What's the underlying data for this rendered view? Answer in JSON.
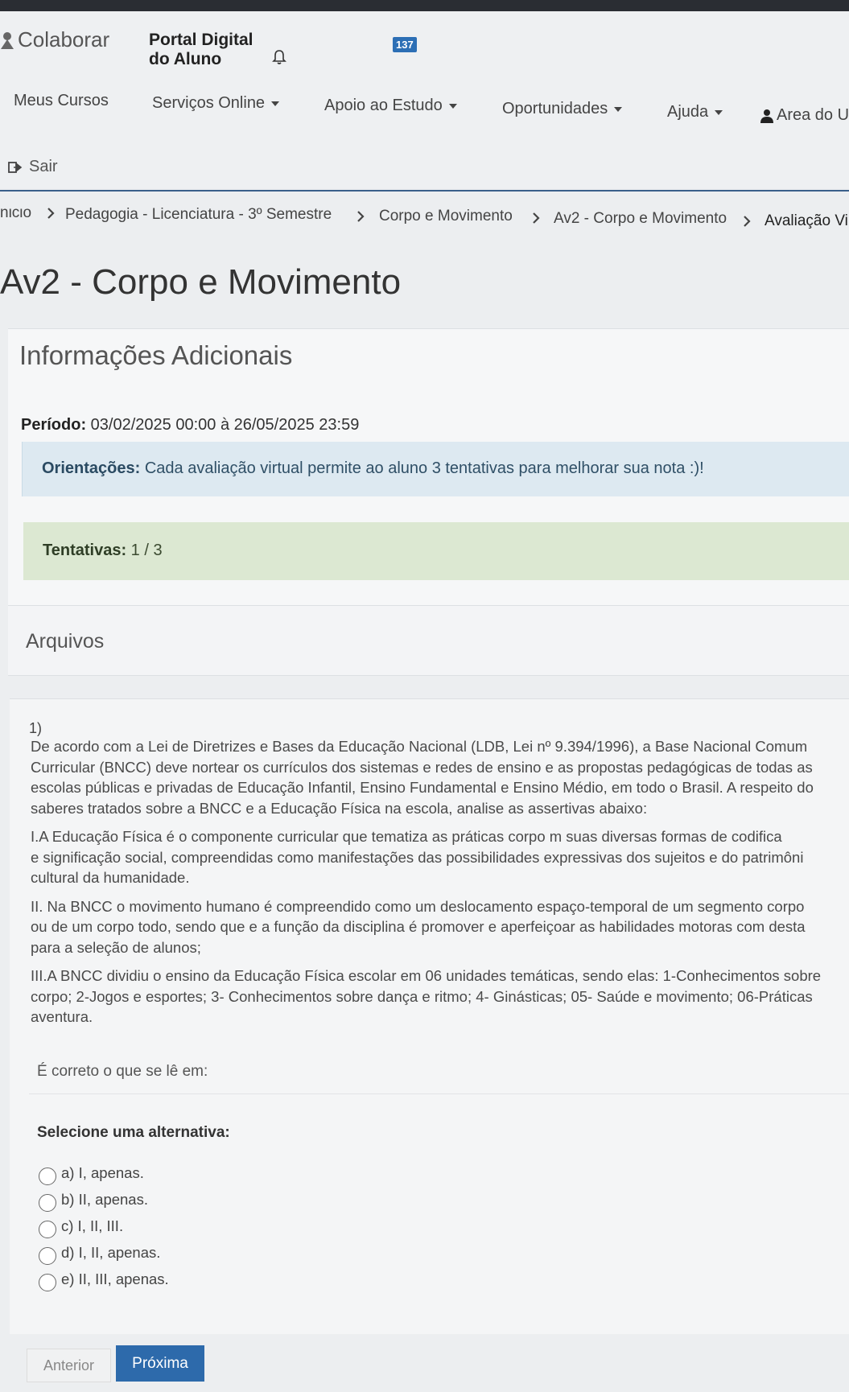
{
  "header": {
    "brand": "Colaborar",
    "portal_line1": "Portal Digital",
    "portal_line2": "do Aluno",
    "notification_count": "137",
    "sair_label": "Sair"
  },
  "nav": {
    "items": [
      {
        "label": "Meus Cursos"
      },
      {
        "label": "Serviços Online"
      },
      {
        "label": "Apoio ao Estudo"
      },
      {
        "label": "Oportunidades"
      },
      {
        "label": "Ajuda"
      },
      {
        "label": "Area do U"
      }
    ]
  },
  "breadcrumb": [
    "nicio",
    "Pedagogia - Licenciatura - 3º Semestre",
    "Corpo e Movimento",
    "Av2 - Corpo e Movimento",
    "Avaliação Vi"
  ],
  "page_title": "Av2 - Corpo e Movimento",
  "info": {
    "title": "Informações Adicionais",
    "periodo_label": "Período:",
    "periodo_value": " 03/02/2025 00:00 à 26/05/2025 23:59",
    "orient_label": "Orientações:",
    "orient_value": " Cada avaliação virtual permite ao aluno 3 tentativas para melhorar sua nota :)!",
    "tentativas_label": "Tentativas:",
    "tentativas_value": " 1 / 3",
    "arquivos_title": "Arquivos"
  },
  "question": {
    "number": "1)",
    "paragraphs": [
      [
        "De acordo com a Lei de Diretrizes e Bases da Educação Nacional (LDB, Lei nº 9.394/1996), a Base Nacional Comum",
        "Curricular (BNCC) deve nortear os currículos dos sistemas e redes de ensino e as propostas pedagógicas de todas as",
        "escolas públicas e privadas de Educação Infantil, Ensino Fundamental e Ensino Médio, em todo o Brasil. A respeito do",
        "saberes tratados sobre a BNCC e a Educação Física na escola, analise as assertivas abaixo:"
      ],
      [
        "I.A Educação Física é o componente curricular que tematiza as práticas corpo       m suas diversas formas de codifica",
        "e significação social, compreendidas como manifestações das possibilidades expressivas dos sujeitos e do patrimôni",
        "cultural da humanidade."
      ],
      [
        "II. Na BNCC o movimento humano é compreendido como um deslocamento espaço-temporal de um segmento corpo",
        "ou de um corpo todo, sendo que e a função da disciplina é promover e aperfeiçoar as habilidades motoras com desta",
        "para a seleção de alunos;"
      ],
      [
        "III.A BNCC dividiu o ensino da Educação Física escolar em 06 unidades temáticas, sendo elas: 1-Conhecimentos sobre",
        "corpo; 2-Jogos e esportes; 3- Conhecimentos sobre dança e ritmo; 4- Ginásticas; 05- Saúde e movimento; 06-Práticas",
        "aventura."
      ]
    ],
    "prompt": "É correto o que se lê em:",
    "select_label": "Selecione uma alternativa:",
    "options": [
      "a) I, apenas.",
      "b) II, apenas.",
      "c) I, II, III.",
      "d) I, II, apenas.",
      "e) II, III, apenas."
    ]
  },
  "buttons": {
    "previous": "Anterior",
    "next": "Próxima"
  }
}
